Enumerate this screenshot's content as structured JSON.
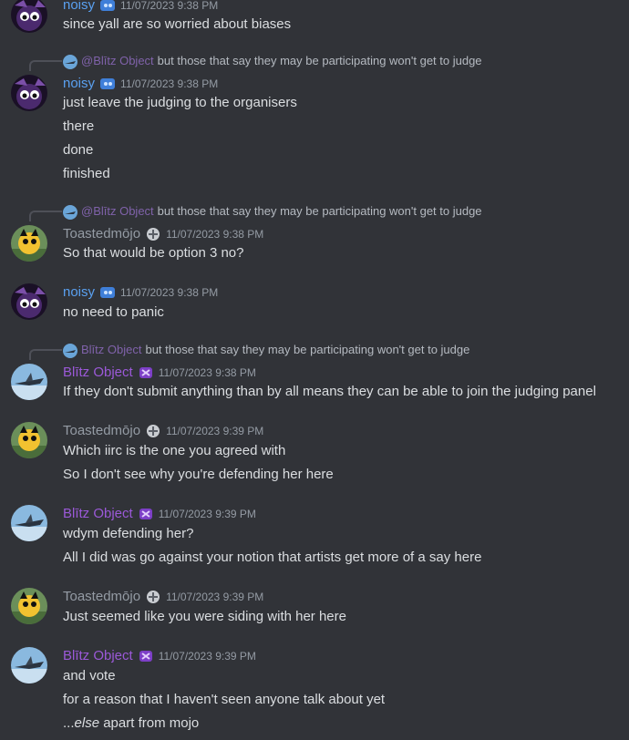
{
  "users": {
    "noisy": "noisy",
    "blitz": "Blītz Object",
    "toast": "Toastedmōjo"
  },
  "colors": {
    "background": "#313338",
    "noisy": "#5aa0f0",
    "blitz": "#9b59d8",
    "toast": "#949ba4",
    "text": "#dbdee1",
    "timestamp": "#949ba4"
  },
  "messages": [
    {
      "author": "noisy",
      "time": "11/07/2023 9:38 PM",
      "lines": [
        "since yall are so worried about biases"
      ]
    },
    {
      "reply": {
        "name": "@Blītz Object",
        "text": "but those that say they may be participating won't get to judge"
      },
      "author": "noisy",
      "time": "11/07/2023 9:38 PM",
      "lines": [
        "just leave the judging to the organisers",
        "there",
        "done",
        "finished"
      ]
    },
    {
      "reply": {
        "name": "@Blītz Object",
        "text": "but those that say they may be participating won't get to judge"
      },
      "author": "Toastedmōjo",
      "time": "11/07/2023 9:38 PM",
      "lines": [
        "So that would be option 3 no?"
      ]
    },
    {
      "author": "noisy",
      "time": "11/07/2023 9:38 PM",
      "lines": [
        "no need to panic"
      ]
    },
    {
      "reply": {
        "name": "Blītz Object",
        "text": "but those that say they may be participating won't get to judge"
      },
      "author": "Blītz Object",
      "time": "11/07/2023 9:38 PM",
      "lines": [
        "If they don't submit anything than by all means they can be able to join the judging panel"
      ]
    },
    {
      "author": "Toastedmōjo",
      "time": "11/07/2023 9:39 PM",
      "lines": [
        "Which iirc is the one you agreed with",
        "So I don't see why you're defending her here"
      ]
    },
    {
      "author": "Blītz Object",
      "time": "11/07/2023 9:39 PM",
      "lines": [
        "wdym defending her?",
        "All I did was go against your notion that artists get more of a say here"
      ]
    },
    {
      "author": "Toastedmōjo",
      "time": "11/07/2023 9:39 PM",
      "lines": [
        "Just seemed like you were siding with her here"
      ]
    },
    {
      "author": "Blītz Object",
      "time": "11/07/2023 9:39 PM",
      "lines": [
        "and vote",
        "for a reason that I haven't seen anyone talk about yet",
        "...",
        "else",
        " apart from mojo"
      ]
    }
  ],
  "icons": [
    "noisy-avatar",
    "blitz-avatar",
    "toast-avatar",
    "role-badge-icon"
  ]
}
